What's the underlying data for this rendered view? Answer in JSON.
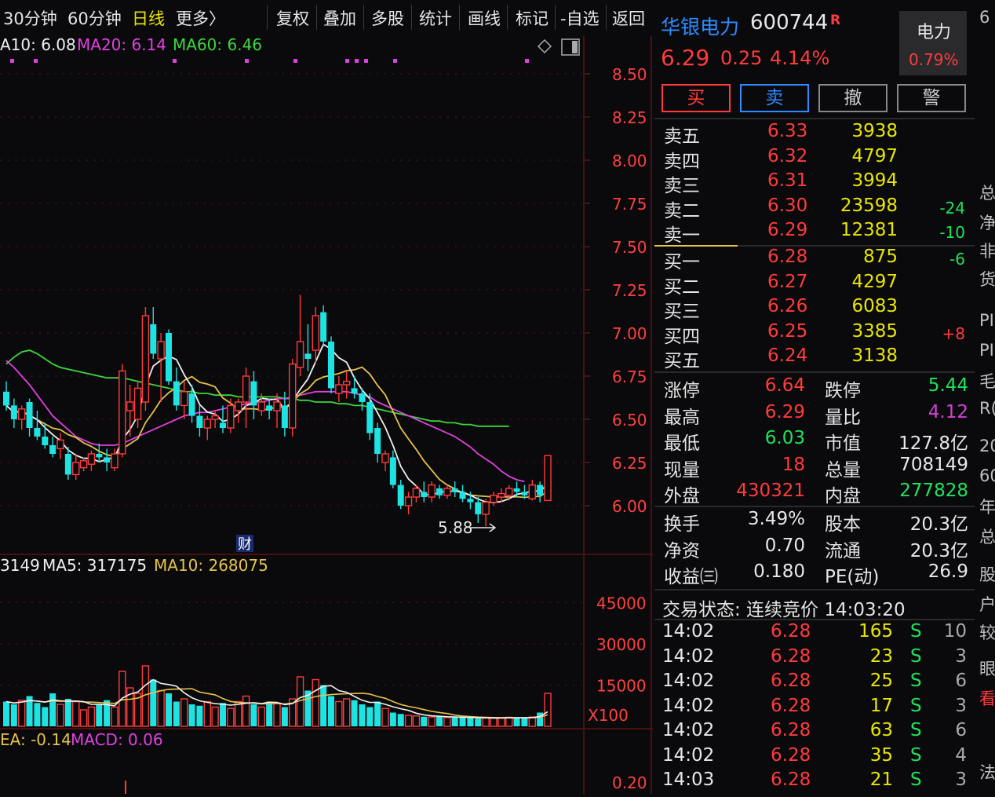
{
  "toolbar": {
    "periods": [
      "30分钟",
      "60分钟",
      "日线",
      "更多〉"
    ],
    "tools": [
      "复权",
      "叠加",
      "多股",
      "统计",
      "画线",
      "标记",
      "-自选",
      "返回"
    ]
  },
  "chart": {
    "ma_legend": [
      {
        "label": "A10: 6.08",
        "color": "#f0f0f0"
      },
      {
        "label": "MA20: 6.14",
        "color": "#e040e0"
      },
      {
        "label": "MA60: 6.46",
        "color": "#3cd63c"
      }
    ],
    "price_ticks": [
      "8.50",
      "8.25",
      "8.00",
      "7.75",
      "7.50",
      "7.25",
      "7.00",
      "6.75",
      "6.50",
      "6.25",
      "6.00"
    ],
    "low_marker": "5.88",
    "cai_badge": "财",
    "volume_legend": [
      {
        "label": "3149",
        "color": "#f0f0f0"
      },
      {
        "label": "MA5: 317175",
        "color": "#f0f0f0"
      },
      {
        "label": "MA10: 268075",
        "color": "#e6c34a"
      }
    ],
    "volume_ticks": [
      "45000",
      "30000",
      "15000"
    ],
    "volume_unit": "X100",
    "macd_legend": [
      {
        "label": "EA: -0.14",
        "color": "#e6c34a"
      },
      {
        "label": "MACD: 0.06",
        "color": "#e040e0"
      }
    ],
    "macd_tick": "0.20"
  },
  "chart_data": {
    "type": "candlestick",
    "ylim": [
      5.85,
      8.6
    ],
    "candles_ohlc": [
      [
        6.66,
        6.72,
        6.55,
        6.58
      ],
      [
        6.58,
        6.62,
        6.45,
        6.5
      ],
      [
        6.5,
        6.58,
        6.44,
        6.56
      ],
      [
        6.6,
        6.62,
        6.4,
        6.45
      ],
      [
        6.45,
        6.55,
        6.38,
        6.4
      ],
      [
        6.4,
        6.48,
        6.33,
        6.35
      ],
      [
        6.35,
        6.4,
        6.28,
        6.3
      ],
      [
        6.33,
        6.42,
        6.27,
        6.38
      ],
      [
        6.3,
        6.34,
        6.15,
        6.18
      ],
      [
        6.18,
        6.3,
        6.15,
        6.25
      ],
      [
        6.22,
        6.28,
        6.2,
        6.26
      ],
      [
        6.24,
        6.32,
        6.2,
        6.3
      ],
      [
        6.3,
        6.36,
        6.25,
        6.28
      ],
      [
        6.28,
        6.33,
        6.2,
        6.25
      ],
      [
        6.22,
        6.33,
        6.2,
        6.3
      ],
      [
        6.3,
        6.82,
        6.28,
        6.78
      ],
      [
        6.55,
        6.7,
        6.4,
        6.6
      ],
      [
        6.5,
        6.72,
        6.45,
        6.68
      ],
      [
        6.6,
        7.15,
        6.55,
        7.1
      ],
      [
        7.05,
        7.15,
        6.85,
        6.88
      ],
      [
        6.85,
        7.0,
        6.6,
        6.95
      ],
      [
        7.0,
        7.02,
        6.7,
        6.72
      ],
      [
        6.72,
        6.8,
        6.55,
        6.58
      ],
      [
        6.58,
        6.72,
        6.5,
        6.66
      ],
      [
        6.65,
        6.7,
        6.48,
        6.52
      ],
      [
        6.52,
        6.58,
        6.4,
        6.45
      ],
      [
        6.45,
        6.52,
        6.38,
        6.5
      ],
      [
        6.5,
        6.55,
        6.45,
        6.52
      ],
      [
        6.48,
        6.58,
        6.42,
        6.45
      ],
      [
        6.45,
        6.62,
        6.42,
        6.58
      ],
      [
        6.55,
        6.62,
        6.48,
        6.6
      ],
      [
        6.6,
        6.8,
        6.45,
        6.75
      ],
      [
        6.72,
        6.78,
        6.5,
        6.58
      ],
      [
        6.55,
        6.65,
        6.52,
        6.6
      ],
      [
        6.58,
        6.62,
        6.5,
        6.55
      ],
      [
        6.55,
        6.65,
        6.45,
        6.6
      ],
      [
        6.58,
        6.66,
        6.4,
        6.45
      ],
      [
        6.45,
        6.85,
        6.4,
        6.82
      ],
      [
        6.8,
        7.22,
        6.75,
        6.95
      ],
      [
        6.88,
        7.05,
        6.78,
        6.85
      ],
      [
        6.9,
        7.15,
        6.82,
        7.1
      ],
      [
        7.12,
        7.16,
        6.92,
        6.95
      ],
      [
        6.95,
        6.98,
        6.65,
        6.68
      ],
      [
        6.65,
        6.75,
        6.6,
        6.7
      ],
      [
        6.7,
        6.78,
        6.62,
        6.72
      ],
      [
        6.68,
        6.75,
        6.62,
        6.65
      ],
      [
        6.65,
        6.68,
        6.55,
        6.6
      ],
      [
        6.6,
        6.65,
        6.38,
        6.42
      ],
      [
        6.45,
        6.48,
        6.25,
        6.3
      ],
      [
        6.25,
        6.32,
        6.2,
        6.3
      ],
      [
        6.28,
        6.32,
        6.1,
        6.12
      ],
      [
        6.12,
        6.15,
        5.98,
        6.0
      ],
      [
        6.0,
        6.08,
        5.95,
        6.05
      ],
      [
        6.05,
        6.12,
        6.02,
        6.1
      ],
      [
        6.08,
        6.14,
        6.02,
        6.05
      ],
      [
        6.05,
        6.14,
        6.02,
        6.12
      ],
      [
        6.1,
        6.12,
        6.04,
        6.06
      ],
      [
        6.06,
        6.12,
        6.04,
        6.1
      ],
      [
        6.1,
        6.14,
        6.05,
        6.08
      ],
      [
        6.08,
        6.12,
        6.02,
        6.04
      ],
      [
        6.04,
        6.08,
        5.98,
        6.02
      ],
      [
        6.02,
        6.05,
        5.9,
        5.95
      ],
      [
        5.95,
        6.04,
        5.88,
        6.02
      ],
      [
        6.02,
        6.08,
        6.0,
        6.06
      ],
      [
        6.05,
        6.1,
        6.02,
        6.07
      ],
      [
        6.06,
        6.12,
        6.03,
        6.1
      ],
      [
        6.1,
        6.14,
        6.05,
        6.08
      ],
      [
        6.08,
        6.12,
        6.04,
        6.06
      ],
      [
        6.04,
        6.15,
        6.03,
        6.12
      ],
      [
        6.12,
        6.14,
        6.02,
        6.06
      ],
      [
        6.03,
        6.29,
        6.03,
        6.29
      ]
    ],
    "ma60_approx": [
      6.82,
      6.86,
      6.89,
      6.9,
      6.88,
      6.85,
      6.82,
      6.8,
      6.79,
      6.78,
      6.77,
      6.76,
      6.75,
      6.74,
      6.74,
      6.74,
      6.73,
      6.72,
      6.71,
      6.7,
      6.69,
      6.68,
      6.67,
      6.66,
      6.66,
      6.65,
      6.65,
      6.64,
      6.64,
      6.64,
      6.63,
      6.63,
      6.63,
      6.63,
      6.63,
      6.63,
      6.62,
      6.62,
      6.61,
      6.61,
      6.6,
      6.6,
      6.6,
      6.59,
      6.59,
      6.58,
      6.58,
      6.57,
      6.56,
      6.55,
      6.54,
      6.53,
      6.52,
      6.51,
      6.5,
      6.49,
      6.49,
      6.48,
      6.48,
      6.47,
      6.47,
      6.46,
      6.46,
      6.46,
      6.46,
      6.46
    ],
    "ma20_approx": [
      6.84,
      6.8,
      6.75,
      6.7,
      6.64,
      6.58,
      6.52,
      6.48,
      6.44,
      6.4,
      6.38,
      6.36,
      6.35,
      6.35,
      6.35,
      6.36,
      6.38,
      6.4,
      6.42,
      6.44,
      6.46,
      6.48,
      6.5,
      6.52,
      6.53,
      6.54,
      6.54,
      6.55,
      6.56,
      6.57,
      6.58,
      6.59,
      6.6,
      6.6,
      6.61,
      6.62,
      6.62,
      6.63,
      6.64,
      6.65,
      6.66,
      6.66,
      6.66,
      6.66,
      6.66,
      6.65,
      6.64,
      6.63,
      6.6,
      6.58,
      6.56,
      6.54,
      6.52,
      6.5,
      6.48,
      6.46,
      6.44,
      6.42,
      6.4,
      6.37,
      6.34,
      6.3,
      6.27,
      6.24,
      6.2,
      6.17,
      6.15,
      6.14
    ],
    "volume_x100": [
      9000,
      8000,
      9500,
      11000,
      8500,
      7000,
      12000,
      8000,
      10000,
      9000,
      6000,
      7000,
      8000,
      9500,
      7000,
      20000,
      14000,
      12000,
      22000,
      17000,
      13000,
      12000,
      9000,
      10000,
      8000,
      7500,
      9000,
      7000,
      8500,
      6500,
      9000,
      11000,
      8000,
      7000,
      9000,
      8500,
      7000,
      10000,
      18000,
      13000,
      17000,
      15000,
      11000,
      9000,
      10000,
      9500,
      8000,
      7000,
      9000,
      6500,
      5000,
      4500,
      4000,
      3800,
      3500,
      3400,
      3600,
      3200,
      3300,
      3100,
      3000,
      2800,
      3200,
      3000,
      3100,
      3300,
      3000,
      3200,
      3400,
      5000,
      12000
    ],
    "volume_ylim": [
      0,
      50000
    ]
  },
  "quote": {
    "name": "华银电力",
    "code": "600744",
    "r_badge": "R",
    "price": "6.29",
    "change": "0.25",
    "pct": "4.14%",
    "sector": "电力",
    "sector_pct": "0.79%",
    "buttons": [
      "买",
      "卖",
      "撤",
      "警"
    ],
    "sells": [
      {
        "label": "卖五",
        "price": "6.33",
        "vol": "3938",
        "chg": ""
      },
      {
        "label": "卖四",
        "price": "6.32",
        "vol": "4797",
        "chg": ""
      },
      {
        "label": "卖三",
        "price": "6.31",
        "vol": "3994",
        "chg": ""
      },
      {
        "label": "卖二",
        "price": "6.30",
        "vol": "23598",
        "chg": "-24"
      },
      {
        "label": "卖一",
        "price": "6.29",
        "vol": "12381",
        "chg": "-10"
      }
    ],
    "buys": [
      {
        "label": "买一",
        "price": "6.28",
        "vol": "875",
        "chg": "-6"
      },
      {
        "label": "买二",
        "price": "6.27",
        "vol": "4297",
        "chg": ""
      },
      {
        "label": "买三",
        "price": "6.26",
        "vol": "6083",
        "chg": ""
      },
      {
        "label": "买四",
        "price": "6.25",
        "vol": "3385",
        "chg": "+8"
      },
      {
        "label": "买五",
        "price": "6.24",
        "vol": "3138",
        "chg": ""
      }
    ],
    "stats": [
      {
        "l1": "涨停",
        "v1": "6.64",
        "c1": "red",
        "l2": "跌停",
        "v2": "5.44",
        "c2": "green"
      },
      {
        "l1": "最高",
        "v1": "6.29",
        "c1": "red",
        "l2": "量比",
        "v2": "4.12",
        "c2": "purple"
      },
      {
        "l1": "最低",
        "v1": "6.03",
        "c1": "green",
        "l2": "市值",
        "v2": "127.8亿",
        "c2": "white"
      },
      {
        "l1": "现量",
        "v1": "18",
        "c1": "red",
        "l2": "总量",
        "v2": "708149",
        "c2": "white"
      },
      {
        "l1": "外盘",
        "v1": "430321",
        "c1": "red",
        "l2": "内盘",
        "v2": "277828",
        "c2": "green"
      }
    ],
    "stats2": [
      {
        "l1": "换手",
        "v1": "3.49%",
        "l2": "股本",
        "v2": "20.3亿"
      },
      {
        "l1": "净资",
        "v1": "0.70",
        "l2": "流通",
        "v2": "20.3亿"
      },
      {
        "l1": "收益㈢",
        "v1": "0.180",
        "l2": "PE(动)",
        "v2": "26.9"
      }
    ],
    "status": "交易状态: 连续竞价 14:03:20",
    "ticks": [
      {
        "time": "14:02",
        "price": "6.28",
        "vol": "165",
        "side": "S",
        "n": "10"
      },
      {
        "time": "14:02",
        "price": "6.28",
        "vol": "23",
        "side": "S",
        "n": "3"
      },
      {
        "time": "14:02",
        "price": "6.28",
        "vol": "25",
        "side": "S",
        "n": "6"
      },
      {
        "time": "14:02",
        "price": "6.28",
        "vol": "17",
        "side": "S",
        "n": "3"
      },
      {
        "time": "14:02",
        "price": "6.28",
        "vol": "63",
        "side": "S",
        "n": "6"
      },
      {
        "time": "14:02",
        "price": "6.28",
        "vol": "35",
        "side": "S",
        "n": "4"
      },
      {
        "time": "14:03",
        "price": "6.28",
        "vol": "21",
        "side": "S",
        "n": "3"
      }
    ]
  },
  "far_strip": [
    "6",
    "总",
    "净",
    "非",
    "货",
    "PI",
    "PI",
    "毛",
    "R(",
    "20",
    "60",
    "年",
    "总",
    "股",
    "户",
    "较",
    "眼",
    "看",
    "法"
  ],
  "colors": {
    "up": "#ff3b3b",
    "down": "#1ee3e3",
    "ma5": "#f0f0f0",
    "ma10": "#e6c34a",
    "ma20": "#e040e0",
    "ma60": "#3cd63c"
  }
}
